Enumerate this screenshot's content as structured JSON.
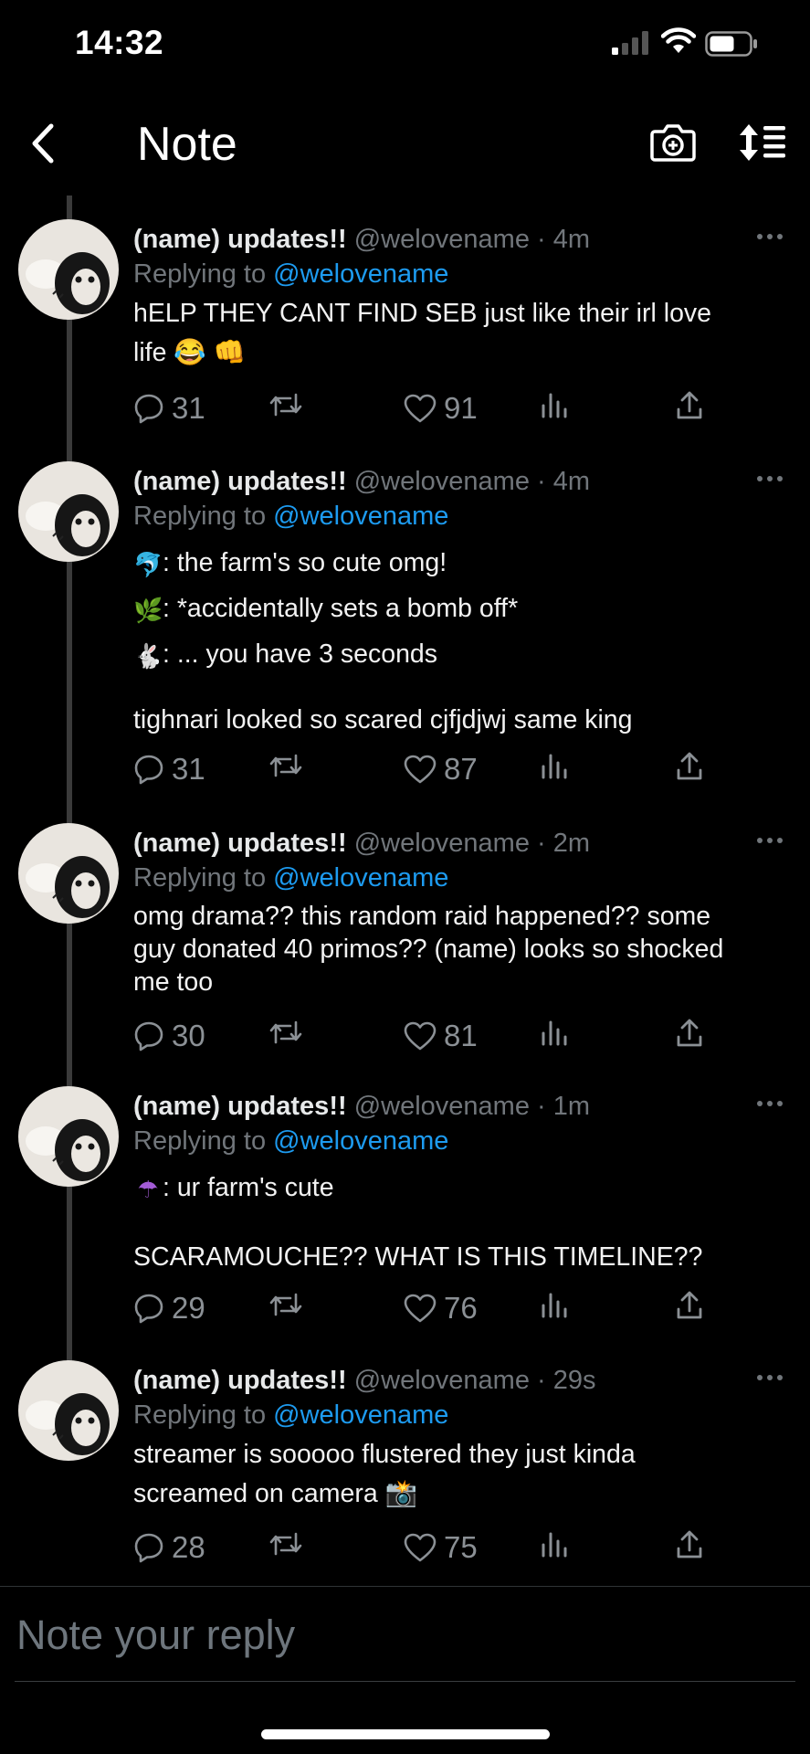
{
  "status_bar": {
    "time": "14:32"
  },
  "nav": {
    "title": "Note"
  },
  "tweets": [
    {
      "name": "(name) updates!!",
      "handle": "@welovename · 4m",
      "replying_prefix": "Replying to",
      "replying_to": "@welovename",
      "lines": [
        "hELP THEY CANT FIND SEB just like their irl love",
        "life 😂 👊"
      ],
      "replies": "31",
      "likes": "91"
    },
    {
      "name": "(name) updates!!",
      "handle": "@welovename · 4m",
      "replying_prefix": "Replying to",
      "replying_to": "@welovename",
      "lines": [
        ": the farm's so cute omg!",
        ": *accidentally sets a bomb off*",
        ": ... you have 3 seconds",
        "tighnari looked so scared cjfjdjwj same king"
      ],
      "line_emojis": [
        "🐬",
        "🌿",
        "🐇"
      ],
      "replies": "31",
      "likes": "87"
    },
    {
      "name": "(name) updates!!",
      "handle": "@welovename · 2m",
      "replying_prefix": "Replying to",
      "replying_to": "@welovename",
      "lines": [
        "omg drama?? this random raid happened?? some",
        "guy donated 40 primos?? (name) looks so shocked",
        "me too"
      ],
      "replies": "30",
      "likes": "81"
    },
    {
      "name": "(name) updates!!",
      "handle": "@welovename · 1m",
      "replying_prefix": "Replying to",
      "replying_to": "@welovename",
      "lines": [
        ": ur farm's cute",
        "SCARAMOUCHE?? WHAT IS THIS TIMELINE??"
      ],
      "line_emojis": [
        "☂"
      ],
      "replies": "29",
      "likes": "76"
    },
    {
      "name": "(name) updates!!",
      "handle": "@welovename · 29s",
      "replying_prefix": "Replying to",
      "replying_to": "@welovename",
      "lines": [
        "streamer is sooooo flustered they just kinda",
        "screamed on camera 📸"
      ],
      "replies": "28",
      "likes": "75"
    }
  ],
  "reply_box": {
    "placeholder": "Note your reply"
  },
  "colors": {
    "background": "#000000",
    "mention": "#1d9bf0",
    "secondary": "#71767b"
  },
  "icons": [
    "back-icon",
    "camera-icon",
    "sort-icon",
    "more-icon",
    "reply-icon",
    "retweet-icon",
    "like-icon",
    "views-icon",
    "share-icon"
  ]
}
